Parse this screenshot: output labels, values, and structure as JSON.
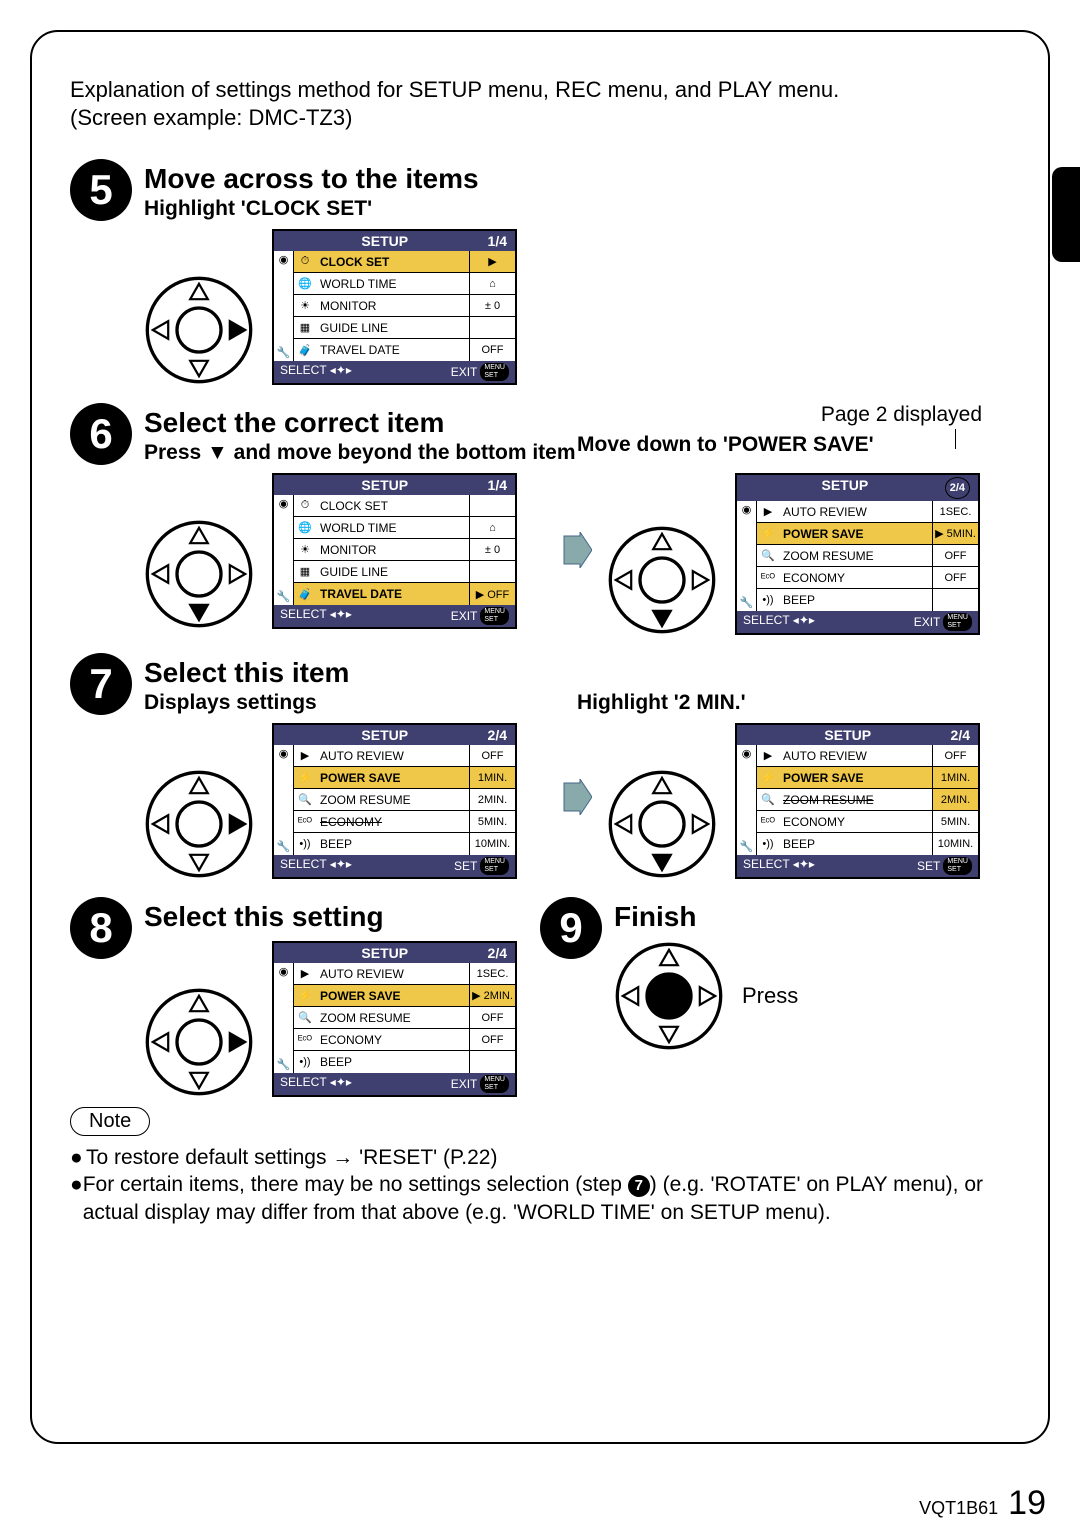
{
  "intro_line": "Explanation of settings method for SETUP menu, REC menu, and PLAY menu.",
  "screen_example": "(Screen example: DMC-TZ3)",
  "steps": {
    "s5": {
      "num": "5",
      "title": "Move across to the items",
      "sub": "Highlight 'CLOCK SET'"
    },
    "s6": {
      "num": "6",
      "title": "Select the correct item",
      "sub": "Press ▼ and move beyond the bottom item",
      "rhs_upper": "Page 2 displayed",
      "rhs_sub": "Move down to 'POWER SAVE'"
    },
    "s7": {
      "num": "7",
      "title": "Select this item",
      "sub": "Displays settings",
      "rhs_sub": "Highlight '2 MIN.'"
    },
    "s8": {
      "num": "8",
      "title": "Select this setting"
    },
    "s9": {
      "num": "9",
      "title": "Finish",
      "press": "Press"
    }
  },
  "menu": {
    "title": "SETUP",
    "footer_select": "SELECT",
    "footer_exit": "EXIT",
    "footer_set": "SET",
    "badge_menu": "MENU",
    "badge_set": "SET"
  },
  "menu5": {
    "page": "1/4",
    "rows": [
      {
        "icon": "⏱",
        "label": "CLOCK SET",
        "value": "▶",
        "hi": true
      },
      {
        "icon": "🌐",
        "label": "WORLD TIME",
        "value": "⌂"
      },
      {
        "icon": "☀",
        "label": "MONITOR",
        "value": "± 0"
      },
      {
        "icon": "▦",
        "label": "GUIDE LINE",
        "value": ""
      },
      {
        "icon": "🧳",
        "label": "TRAVEL DATE",
        "value": "OFF"
      }
    ]
  },
  "menu6L": {
    "page": "1/4",
    "rows": [
      {
        "icon": "⏱",
        "label": "CLOCK SET",
        "value": ""
      },
      {
        "icon": "🌐",
        "label": "WORLD TIME",
        "value": "⌂"
      },
      {
        "icon": "☀",
        "label": "MONITOR",
        "value": "± 0"
      },
      {
        "icon": "▦",
        "label": "GUIDE LINE",
        "value": ""
      },
      {
        "icon": "🧳",
        "label": "TRAVEL DATE",
        "value": "▶  OFF",
        "hi": true
      }
    ]
  },
  "menu6R": {
    "page": "2/4",
    "rows": [
      {
        "icon": "▶",
        "label": "AUTO REVIEW",
        "value": "1SEC."
      },
      {
        "icon": "⚡",
        "label": "POWER SAVE",
        "value": "▶ 5MIN.",
        "hi": true
      },
      {
        "icon": "🔍",
        "label": "ZOOM RESUME",
        "value": "OFF"
      },
      {
        "icon": "ᴱᶜᴼ",
        "label": "ECONOMY",
        "value": "OFF"
      },
      {
        "icon": "•))",
        "label": "BEEP",
        "value": ""
      }
    ]
  },
  "menu7L": {
    "page": "2/4",
    "rows": [
      {
        "icon": "▶",
        "label": "AUTO REVIEW",
        "value": "OFF"
      },
      {
        "icon": "⚡",
        "label": "POWER SAVE",
        "value": "1MIN.",
        "hi": true
      },
      {
        "icon": "🔍",
        "label": "ZOOM RESUME",
        "value": "2MIN."
      },
      {
        "icon": "ᴱᶜᴼ",
        "label": "ECONOMY",
        "value": "5MIN.",
        "strike": true
      },
      {
        "icon": "•))",
        "label": "BEEP",
        "value": "10MIN."
      }
    ]
  },
  "menu7R": {
    "page": "2/4",
    "rows": [
      {
        "icon": "▶",
        "label": "AUTO REVIEW",
        "value": "OFF"
      },
      {
        "icon": "⚡",
        "label": "POWER SAVE",
        "value": "1MIN.",
        "hi": true
      },
      {
        "icon": "🔍",
        "label": "ZOOM RESUME",
        "value": "2MIN.",
        "hi_val": true,
        "strike": true
      },
      {
        "icon": "ᴱᶜᴼ",
        "label": "ECONOMY",
        "value": "5MIN."
      },
      {
        "icon": "•))",
        "label": "BEEP",
        "value": "10MIN."
      }
    ]
  },
  "menu8": {
    "page": "2/4",
    "rows": [
      {
        "icon": "▶",
        "label": "AUTO REVIEW",
        "value": "1SEC."
      },
      {
        "icon": "⚡",
        "label": "POWER SAVE",
        "value": "▶ 2MIN.",
        "hi": true
      },
      {
        "icon": "🔍",
        "label": "ZOOM RESUME",
        "value": "OFF"
      },
      {
        "icon": "ᴱᶜᴼ",
        "label": "ECONOMY",
        "value": "OFF"
      },
      {
        "icon": "•))",
        "label": "BEEP",
        "value": ""
      }
    ]
  },
  "note_label": "Note",
  "notes": {
    "n1": "To restore default settings → 'RESET' (P.22)",
    "n2a": "For certain items, there may be no settings selection (step ",
    "n2num": "7",
    "n2b": ") (e.g. 'ROTATE' on PLAY menu), or actual display may differ from that above (e.g. 'WORLD TIME' on SETUP menu)."
  },
  "footer": {
    "code": "VQT1B61",
    "page": "19"
  }
}
